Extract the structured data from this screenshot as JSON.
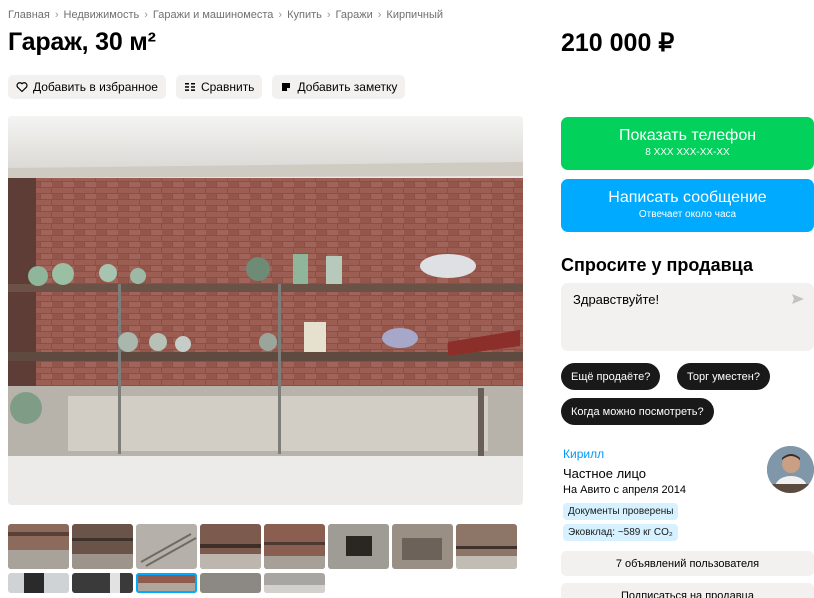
{
  "breadcrumbs": [
    "Главная",
    "Недвижимость",
    "Гаражи и машиноместа",
    "Купить",
    "Гаражи",
    "Кирпичный"
  ],
  "title": "Гараж, 30 м²",
  "price": "210 000 ₽",
  "actions": {
    "favorite": "Добавить в избранное",
    "compare": "Сравнить",
    "note": "Добавить заметку"
  },
  "gallery": {
    "main_photo": "photo-garage-shelves",
    "thumbnails": 13,
    "selected_index": 10
  },
  "contact": {
    "phone_label": "Показать телефон",
    "phone_sub": "8 XXX XXX-XX-XX",
    "message_label": "Написать сообщение",
    "message_sub": "Отвечает около часа"
  },
  "ask": {
    "heading": "Спросите у продавца",
    "message_value": "Здравствуйте!",
    "chips": [
      "Ещё продаёте?",
      "Торг уместен?",
      "Когда можно посмотреть?"
    ]
  },
  "seller": {
    "name": "Кирилл",
    "type": "Частное лицо",
    "since": "На Авито с апреля 2014",
    "badge_docs": "Документы проверены",
    "badge_eco": "Эковклад: ~589 кг CO₂",
    "listings": "7 объявлений пользователя",
    "subscribe": "Подписаться на продавца"
  },
  "colors": {
    "green": "#02d15c",
    "blue": "#00aaff",
    "link": "#0099f7",
    "chip": "#191919"
  }
}
